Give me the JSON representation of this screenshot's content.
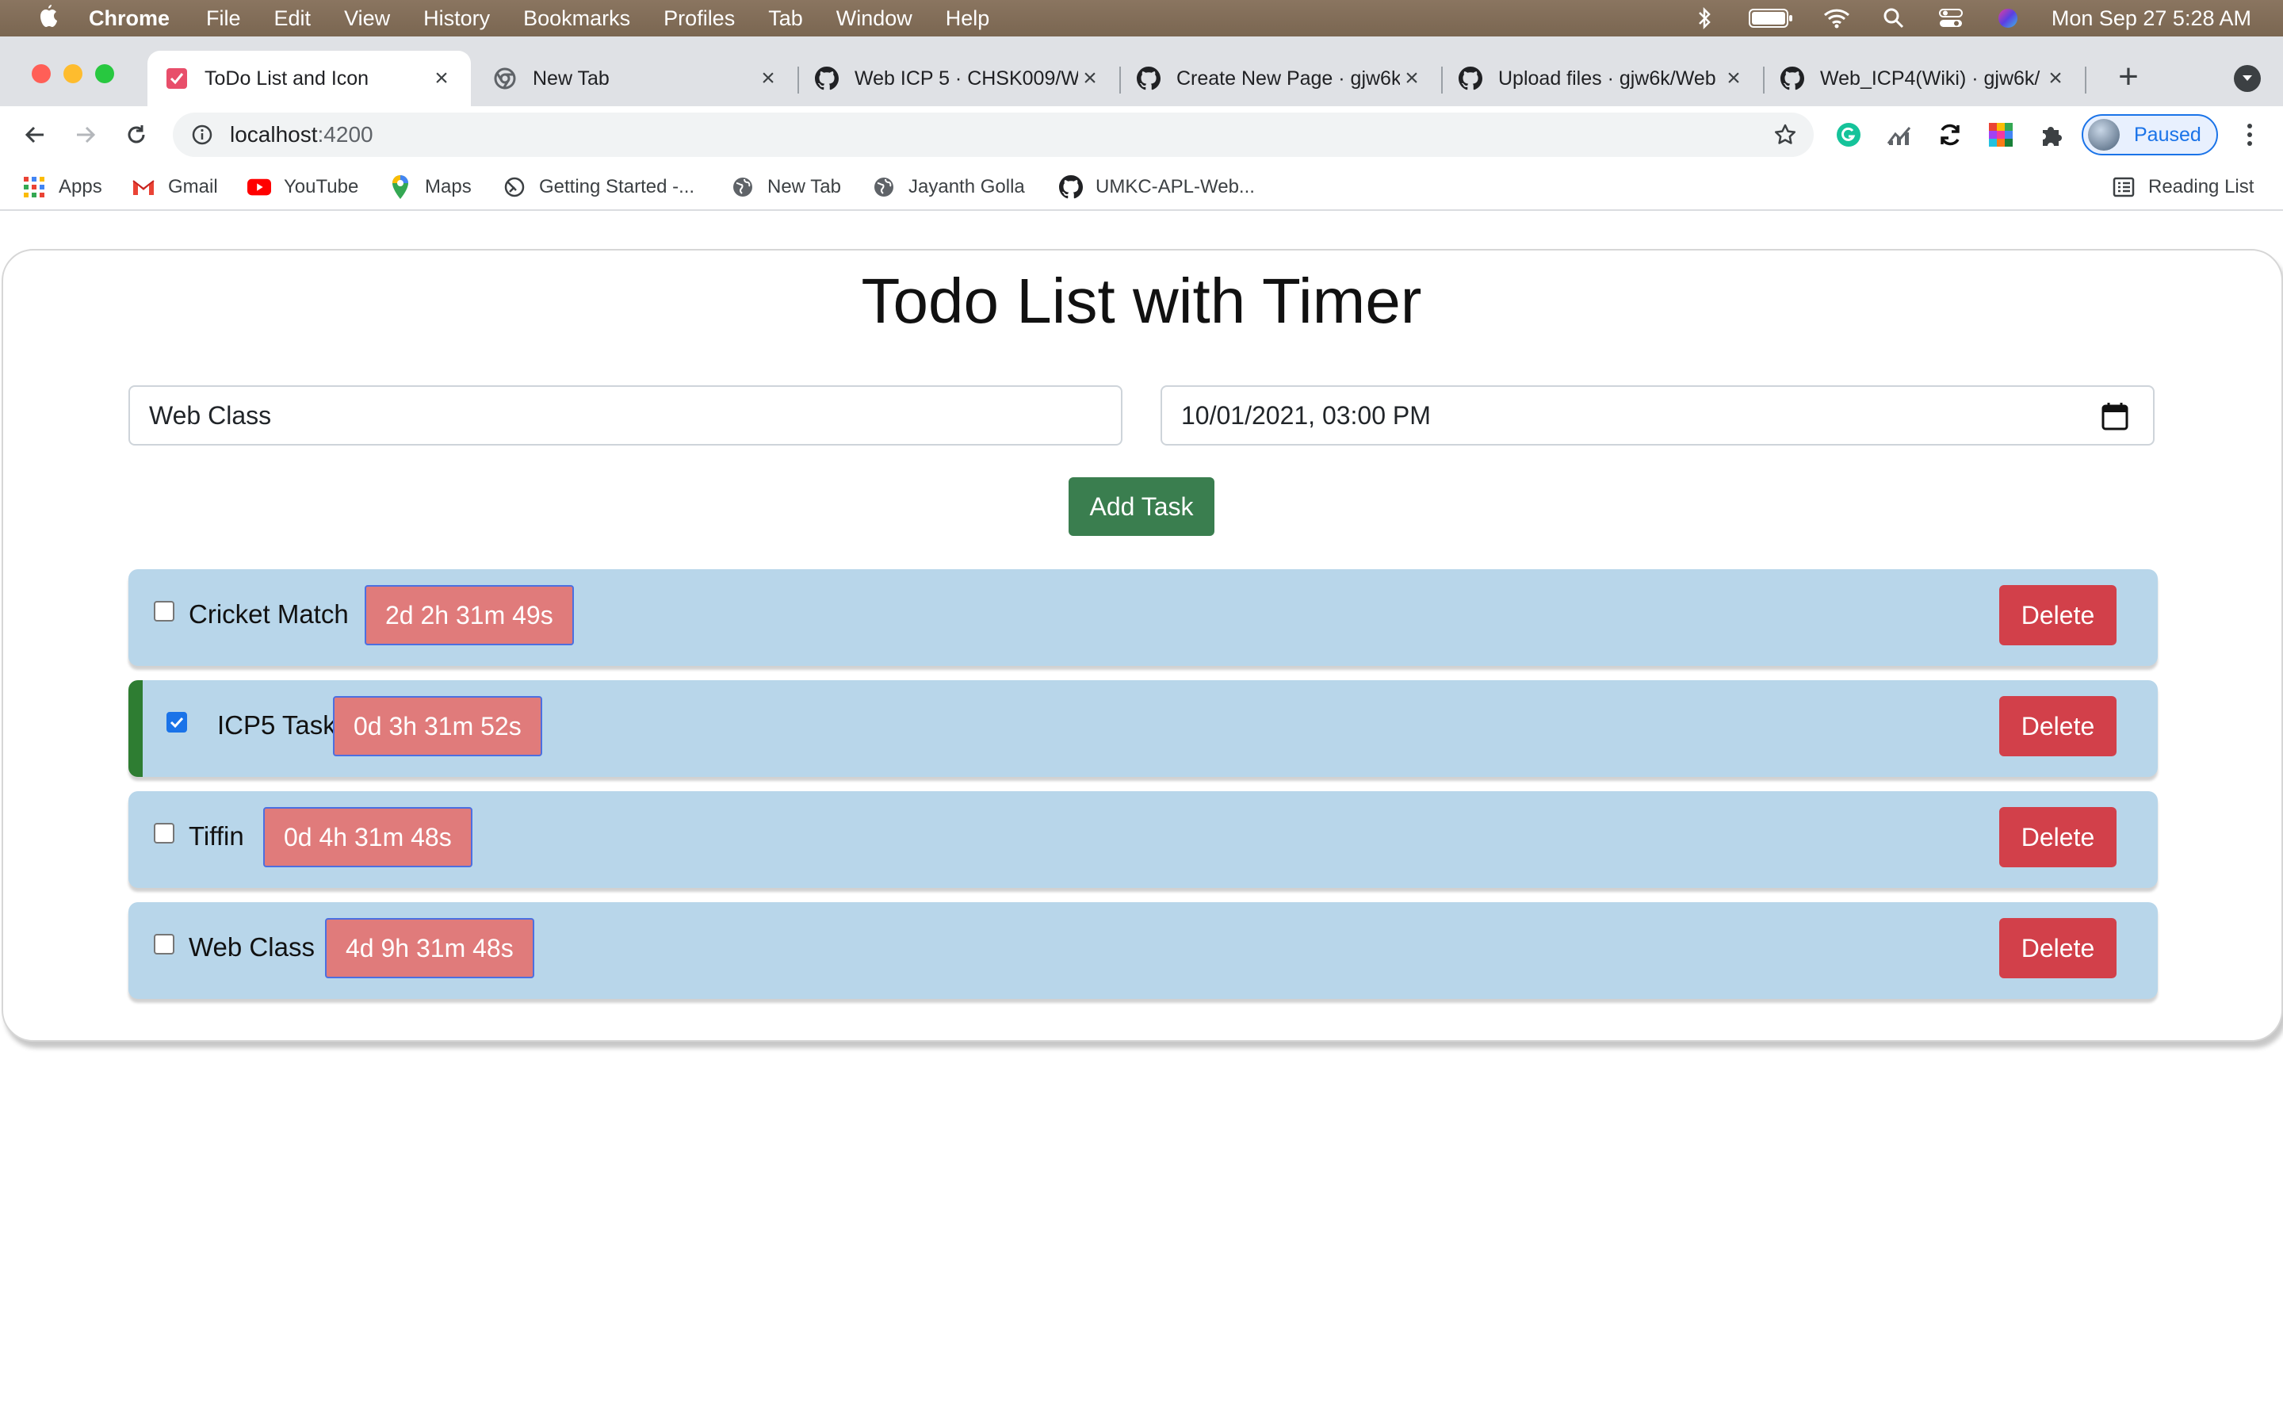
{
  "menubar": {
    "app_name": "Chrome",
    "items": [
      "File",
      "Edit",
      "View",
      "History",
      "Bookmarks",
      "Profiles",
      "Tab",
      "Window",
      "Help"
    ],
    "clock": "Mon Sep 27  5:28 AM"
  },
  "tabs": [
    {
      "title": "ToDo List and Icon",
      "favicon": "todo-app-icon",
      "active": true
    },
    {
      "title": "New Tab",
      "favicon": "chrome-icon",
      "active": false
    },
    {
      "title": "Web ICP 5 · CHSK009/W",
      "favicon": "github-icon",
      "active": false
    },
    {
      "title": "Create New Page · gjw6k",
      "favicon": "github-icon",
      "active": false
    },
    {
      "title": "Upload files · gjw6k/Web",
      "favicon": "github-icon",
      "active": false
    },
    {
      "title": "Web_ICP4(Wiki) · gjw6k/",
      "favicon": "github-icon",
      "active": false
    }
  ],
  "toolbar": {
    "url_host": "localhost",
    "url_port": ":4200",
    "profile_status": "Paused"
  },
  "bookmarks": [
    {
      "label": "Apps",
      "icon": "apps-grid-icon"
    },
    {
      "label": "Gmail",
      "icon": "gmail-icon"
    },
    {
      "label": "YouTube",
      "icon": "youtube-icon"
    },
    {
      "label": "Maps",
      "icon": "maps-icon"
    },
    {
      "label": "Getting Started -...",
      "icon": "getting-started-icon"
    },
    {
      "label": "New Tab",
      "icon": "globe-icon"
    },
    {
      "label": "Jayanth Golla",
      "icon": "globe-icon"
    },
    {
      "label": "UMKC-APL-Web...",
      "icon": "github-icon"
    }
  ],
  "reading_list": "Reading List",
  "app": {
    "title": "Todo List with Timer",
    "task_input_value": "Web Class",
    "datetime_value": "10/01/2021, 03:00 PM",
    "add_button": "Add Task",
    "delete_label": "Delete",
    "tasks": [
      {
        "name": "Cricket Match",
        "timer": "2d 2h 31m 49s",
        "completed": false
      },
      {
        "name": "ICP5 Task",
        "timer": "0d 3h 31m 52s",
        "completed": true
      },
      {
        "name": "Tiffin",
        "timer": "0d 4h 31m 48s",
        "completed": false
      },
      {
        "name": "Web Class",
        "timer": "4d 9h 31m 48s",
        "completed": false
      }
    ]
  },
  "colors": {
    "task_bg": "#b8d6ea",
    "timer_bg": "#e07b7b",
    "delete_bg": "#d2404a",
    "add_bg": "#3a7e4f",
    "completed_accent": "#2e7d32"
  }
}
